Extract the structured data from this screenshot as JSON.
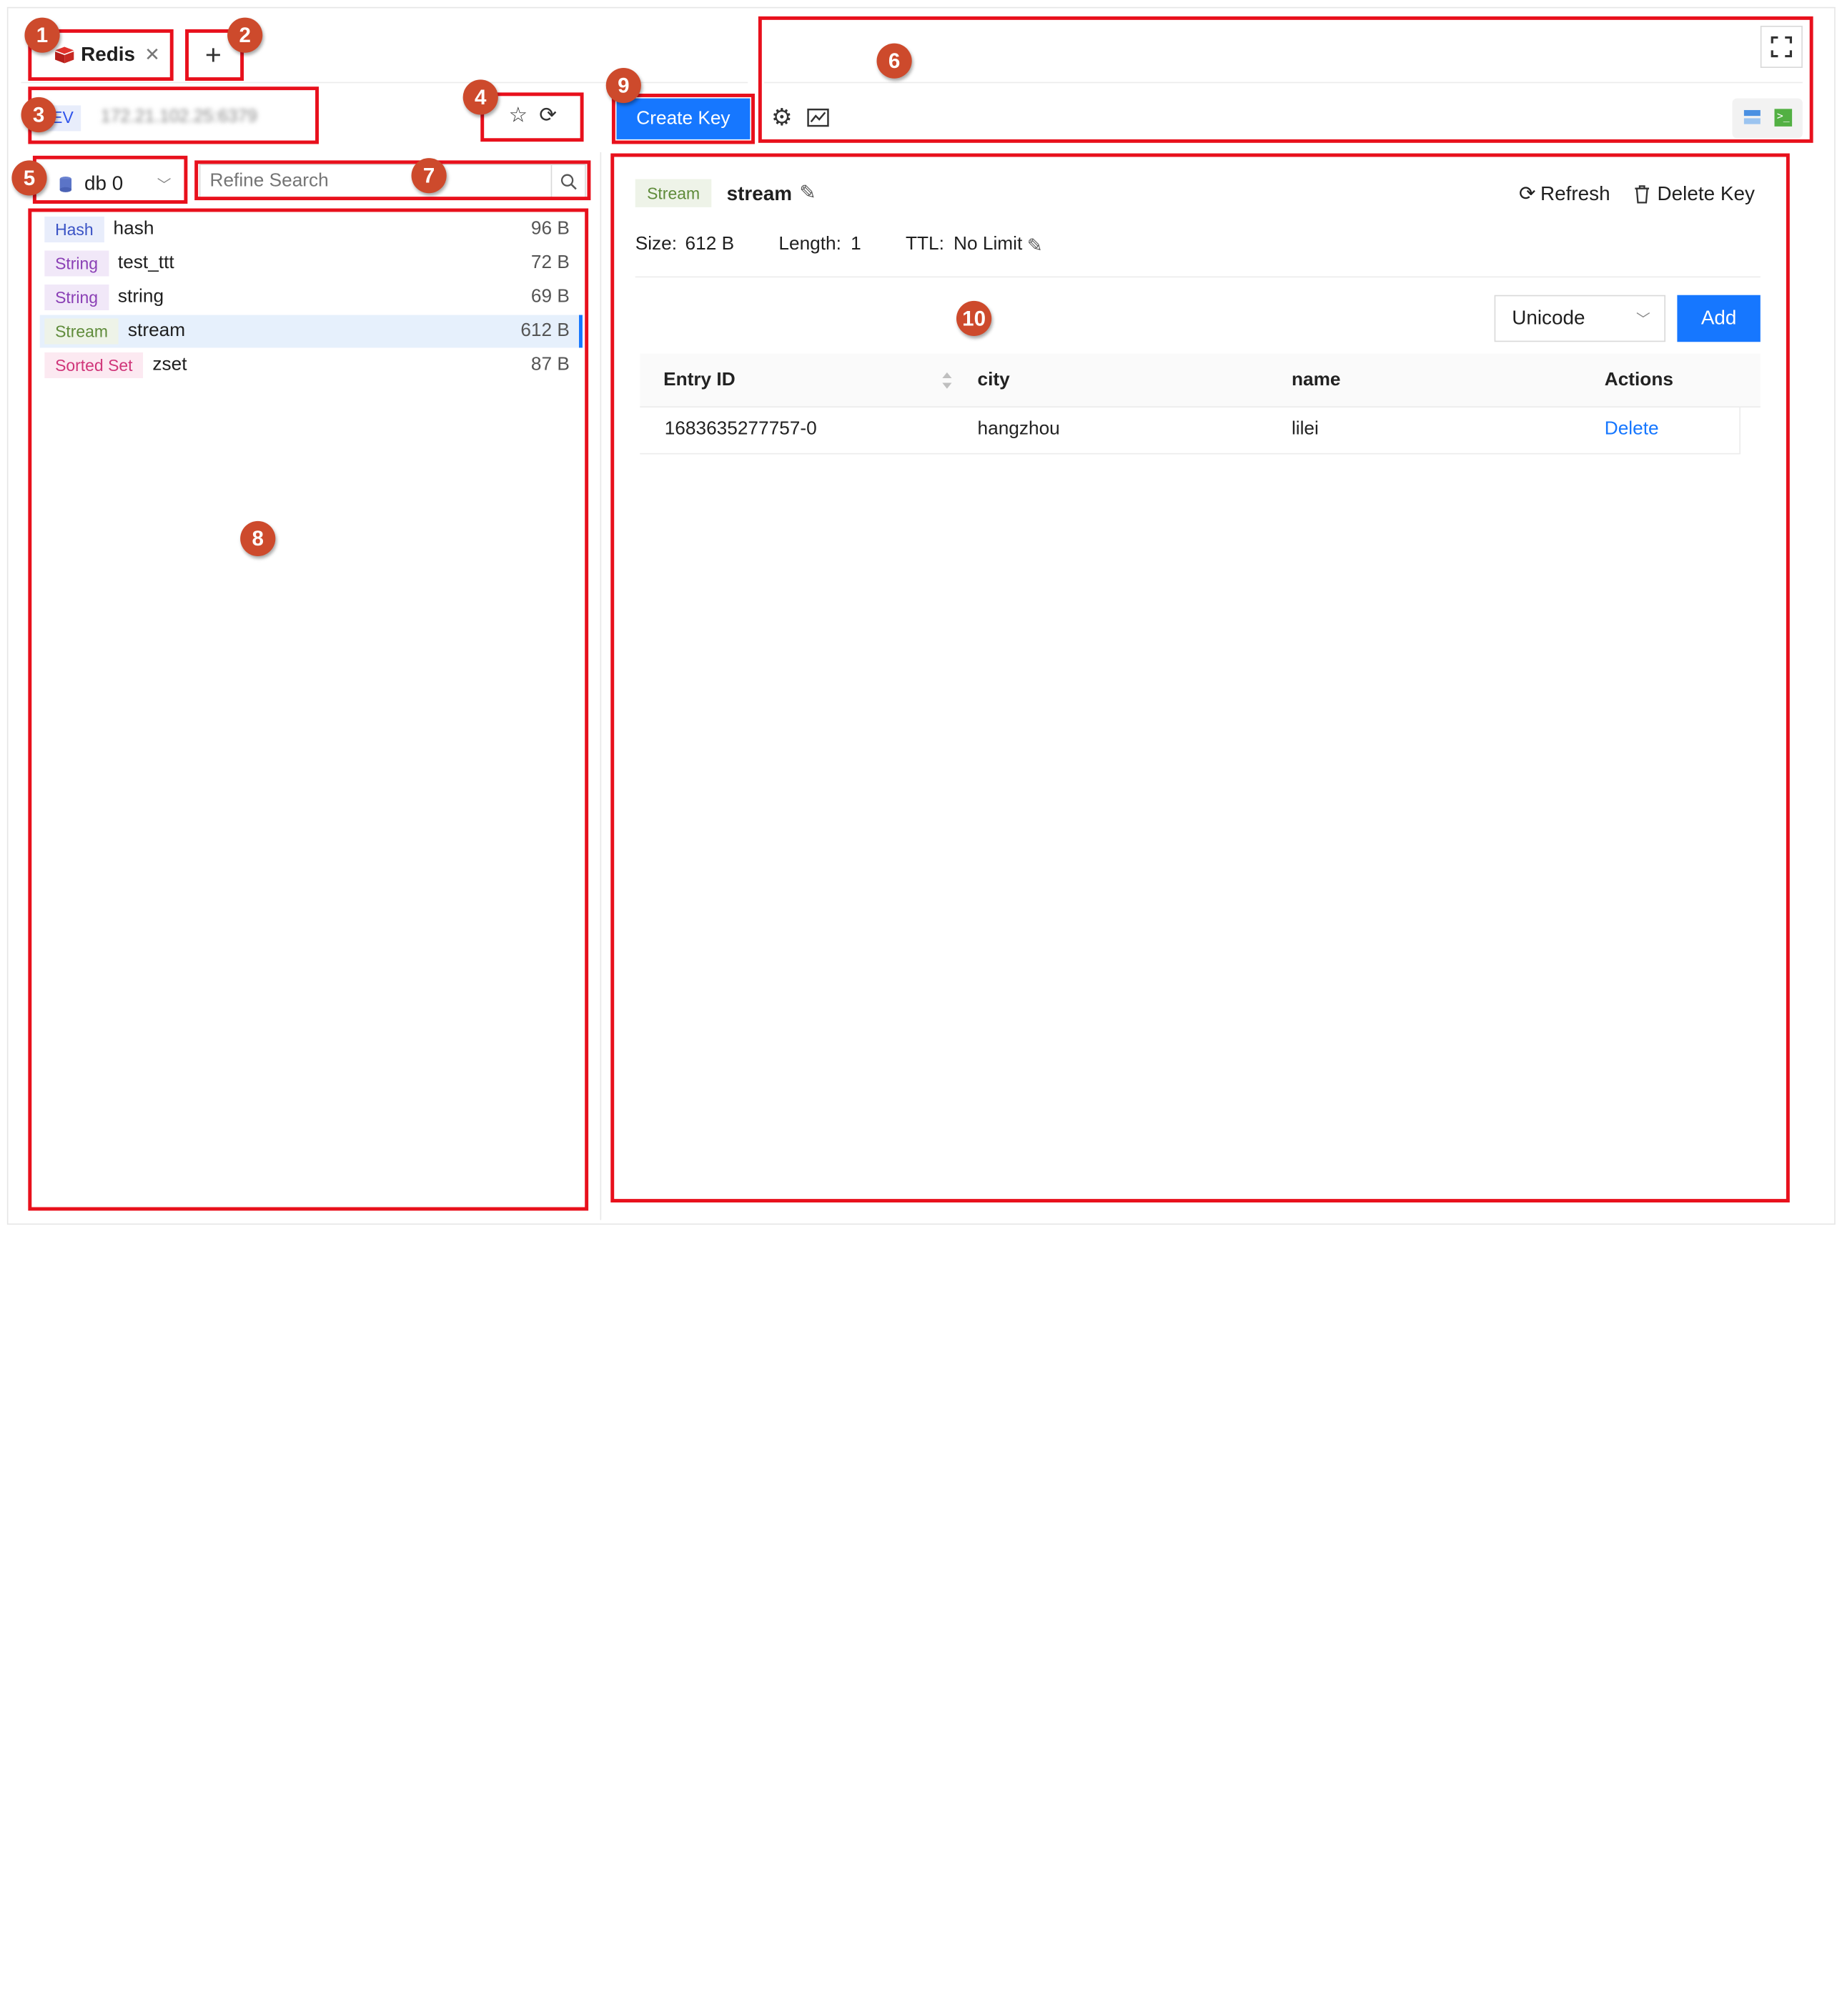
{
  "app": {
    "tabs": [
      {
        "label": "Redis"
      }
    ],
    "connection": {
      "env_label": "EV",
      "address": "172.21.102.25:6379"
    }
  },
  "sidebar": {
    "db_select": "db 0",
    "search": {
      "placeholder": "Refine Search",
      "value": ""
    },
    "keys": [
      {
        "type": "Hash",
        "name": "hash",
        "size": "96 B"
      },
      {
        "type": "String",
        "name": "test_ttt",
        "size": "72 B"
      },
      {
        "type": "String",
        "name": "string",
        "size": "69 B"
      },
      {
        "type": "Stream",
        "name": "stream",
        "size": "612 B",
        "selected": true
      },
      {
        "type": "Sorted Set",
        "name": "zset",
        "size": "87 B"
      }
    ]
  },
  "toolbar": {
    "create_key_label": "Create Key"
  },
  "detail": {
    "type_tag": "Stream",
    "key_name": "stream",
    "refresh_label": "Refresh",
    "delete_key_label": "Delete Key",
    "size_label": "Size:",
    "size_value": "612 B",
    "length_label": "Length:",
    "length_value": "1",
    "ttl_label": "TTL:",
    "ttl_value": "No Limit",
    "format_select": "Unicode",
    "add_label": "Add",
    "table": {
      "columns": [
        "Entry ID",
        "city",
        "name",
        "Actions"
      ],
      "rows": [
        {
          "entry_id": "1683635277757-0",
          "city": "hangzhou",
          "name": "lilei",
          "action": "Delete"
        }
      ]
    }
  },
  "annotations": [
    "1",
    "2",
    "3",
    "4",
    "5",
    "6",
    "7",
    "8",
    "9",
    "10"
  ],
  "colors": {
    "primary": "#1677ff",
    "annotation_box": "#e8101c",
    "annotation_badge": "#cd4a2c",
    "selected_row": "#e6f0fc",
    "tag_hash": "#e8edfb",
    "tag_string": "#f1e8f8",
    "tag_stream": "#eef3e8",
    "tag_sorted_set": "#fce9f1"
  }
}
